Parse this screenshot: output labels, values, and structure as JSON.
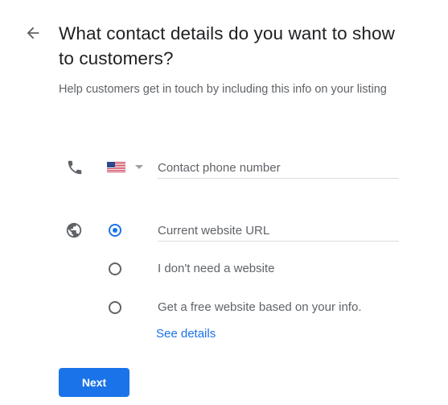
{
  "header": {
    "title": "What contact details do you want to show to customers?",
    "subtitle": "Help customers get in touch by including this info on your listing"
  },
  "phone": {
    "country": "United States",
    "placeholder": "Contact phone number",
    "value": ""
  },
  "website": {
    "options": [
      {
        "label": "Current website URL",
        "type": "input",
        "checked": true,
        "placeholder": "Current website URL"
      },
      {
        "label": "I don't need a website",
        "checked": false
      },
      {
        "label": "Get a free website based on your info.",
        "checked": false
      }
    ],
    "see_details": "See details"
  },
  "actions": {
    "next_label": "Next"
  },
  "colors": {
    "accent": "#1a73e8",
    "text_primary": "#202124",
    "text_secondary": "#5f6368",
    "divider": "#dadce0"
  }
}
